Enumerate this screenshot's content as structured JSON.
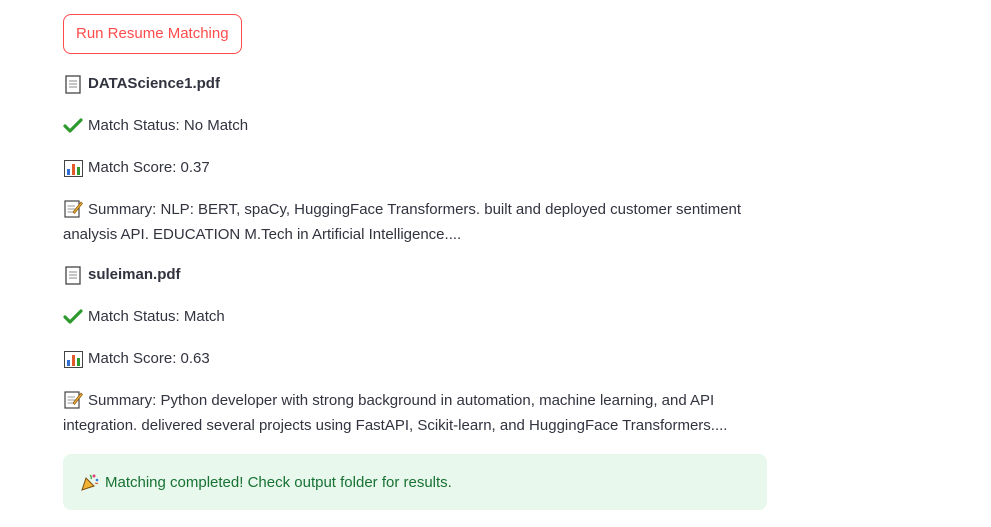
{
  "run_button": {
    "label": "Run Resume Matching"
  },
  "results": [
    {
      "file_name": "DATAScience1.pdf",
      "status_text": "Match Status: No Match",
      "score_text": "Match Score: 0.37",
      "summary_text": "Summary: NLP: BERT, spaCy, HuggingFace Transformers. built and deployed customer sentiment analysis API. EDUCATION M.Tech in Artificial Intelligence...."
    },
    {
      "file_name": "suleiman.pdf",
      "status_text": "Match Status: Match",
      "score_text": "Match Score: 0.63",
      "summary_text": "Summary: Python developer with strong background in automation, machine learning, and API integration. delivered several projects using FastAPI, Scikit-learn, and HuggingFace Transformers...."
    }
  ],
  "success_message": "Matching completed! Check output folder for results.",
  "colors": {
    "accent": "#ff4b4b",
    "success_bg": "#e8f8ec",
    "success_text": "#177233",
    "check": "#2e9a2e"
  },
  "icons": [
    "page-icon",
    "checkmark-icon",
    "bar-chart-icon",
    "memo-icon",
    "party-popper-icon"
  ]
}
